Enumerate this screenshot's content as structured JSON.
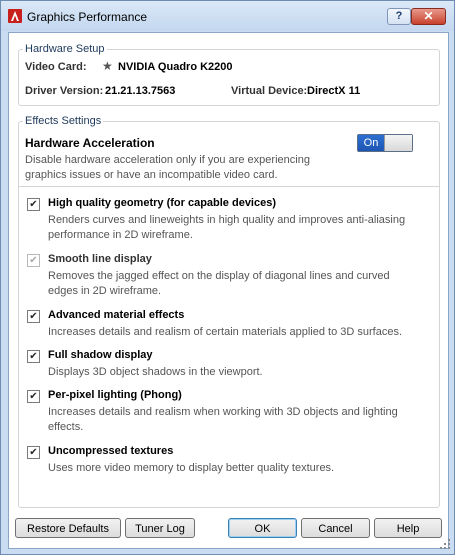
{
  "window": {
    "title": "Graphics Performance"
  },
  "titlebar": {
    "help_label": "?",
    "close_label": "✕"
  },
  "hardware_setup": {
    "legend": "Hardware Setup",
    "video_card_label": "Video Card:",
    "video_card_value": "NVIDIA Quadro K2200",
    "driver_version_label": "Driver Version:",
    "driver_version_value": "21.21.13.7563",
    "virtual_device_label": "Virtual Device:",
    "virtual_device_value": "DirectX 11"
  },
  "effects_settings": {
    "legend": "Effects Settings",
    "hardware_acceleration": {
      "title": "Hardware Acceleration",
      "toggle_label": "On",
      "desc_line1": "Disable hardware acceleration only if you are experiencing",
      "desc_line2": "graphics issues or have an incompatible video card."
    },
    "options": [
      {
        "title": "High quality geometry (for capable devices)",
        "line1": "Renders curves and lineweights in high quality and improves anti-aliasing",
        "line2": "performance in 2D wireframe.",
        "checked": true,
        "enabled": true
      },
      {
        "title": "Smooth line display",
        "line1": "Removes the jagged effect on the display of diagonal lines and curved",
        "line2": "edges in 2D wireframe.",
        "checked": true,
        "enabled": false
      },
      {
        "title": "Advanced material effects",
        "line1": "Increases details and realism of certain materials applied to 3D surfaces.",
        "checked": true,
        "enabled": true
      },
      {
        "title": "Full shadow display",
        "line1": "Displays 3D object shadows in the viewport.",
        "checked": true,
        "enabled": true
      },
      {
        "title": "Per-pixel lighting (Phong)",
        "line1": "Increases details and realism when working with 3D objects and lighting",
        "line2": "effects.",
        "checked": true,
        "enabled": true
      },
      {
        "title": "Uncompressed textures",
        "line1": "Uses more video memory to display better quality textures.",
        "checked": true,
        "enabled": true
      }
    ]
  },
  "buttons": {
    "restore_defaults": "Restore Defaults",
    "tuner_log": "Tuner Log",
    "ok": "OK",
    "cancel": "Cancel",
    "help": "Help"
  },
  "icons": {
    "app": "autocad-logo-icon",
    "video_card": "star-icon",
    "check": "checkmark-icon"
  },
  "colors": {
    "toggle_on": "#1e55b3",
    "title_bar": "#c9dcf2",
    "close_button": "#c7412c",
    "app_icon": "#c8201c"
  }
}
